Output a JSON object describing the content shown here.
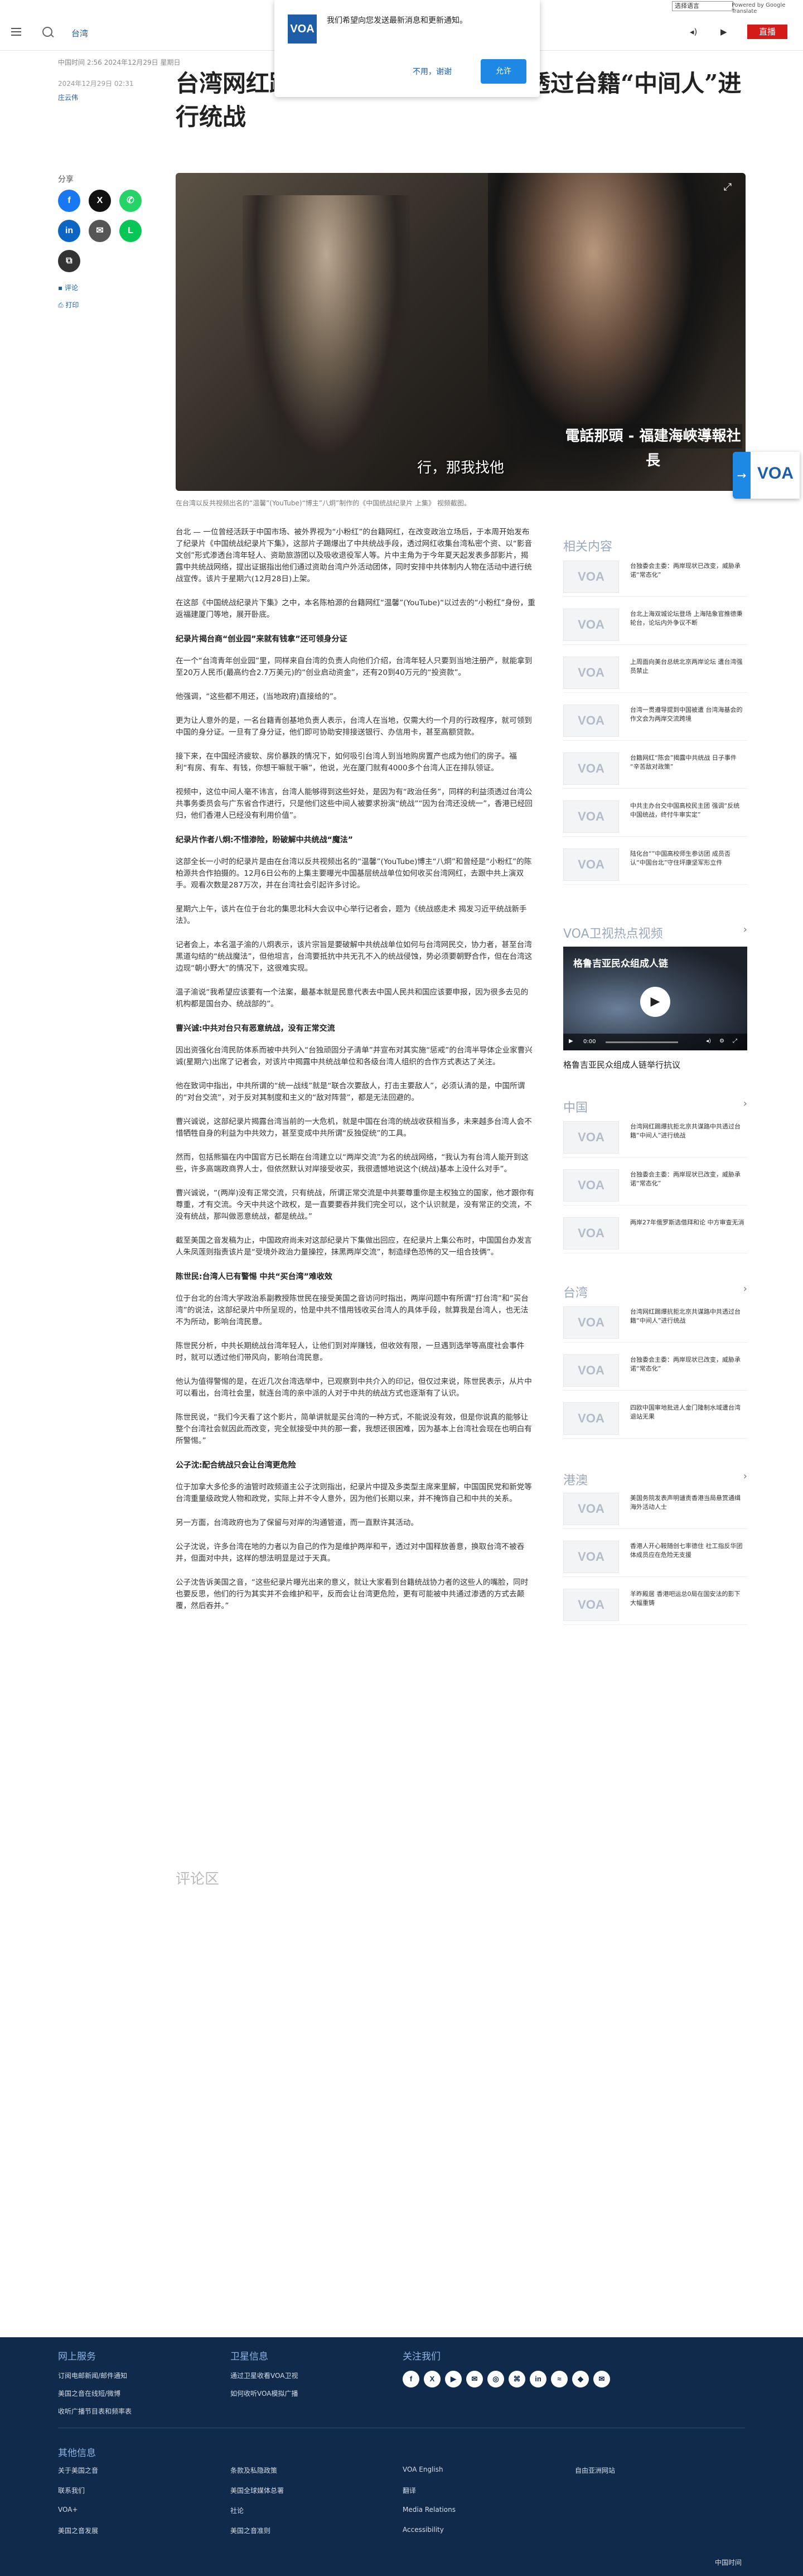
{
  "top": {
    "language_select": "选择语言",
    "powered_by": "Powered by Google Translate"
  },
  "header": {
    "section": "台湾",
    "audio_label": "◂)",
    "video_label": "▶",
    "live_button": "直播"
  },
  "notification": {
    "logo": "VOA",
    "message": "我们希望向您发送最新消息和更新通知。",
    "decline": "不用，谢谢",
    "accept": "允许"
  },
  "article": {
    "meta": "中国时间 2:56 2024年12月29日 星期日",
    "date": "2024年12月29日 02:31",
    "author": "庄云伟",
    "headline": "台湾网红踢爆抗拒北京共谋路中共透过台籍“中间人”进行统战",
    "photo_caption": "在台湾以反共视频出名的“温馨”(YouTube)“博主”八炯”制作的《中国统战纪录片 上集》 视频截图。",
    "hero_caption_box": "電話那頭 - 福建海峽導報社長",
    "hero_subtitle": "行，那我找他"
  },
  "share": {
    "label": "分享",
    "comment": "评论",
    "print": "打印"
  },
  "body": [
    {
      "t": "p",
      "text": "台北 — 一位曾经活跃于中国市场、被外界视为“小粉红”的台籍网红，在改变政治立场后，于本周开始发布了纪录片《中国统战纪录片下集》，这部片子踢爆出了中共统战手段，透过网红收集台湾私密个资、以“影音文创”形式渗透台湾年轻人、资助旅游团以及吸收退役军人等。片中主角为于今年夏天起发表多部影片，揭露中共统战网络，提出证据指出他们通过资助台湾户外活动团体，同时安排中共体制内人物在活动中进行统战宣传。该片于星期六(12月28日)上架。"
    },
    {
      "t": "p",
      "text": "在这部《中国统战纪录片下集》之中，本名陈柏源的台籍网红“温馨”(YouTube)“以过去的“小粉红”身份，重返福建厦门等地，展开卧底。"
    },
    {
      "t": "h",
      "text": "纪录片揭台商“创业园”来就有钱拿”还可领身分证"
    },
    {
      "t": "p",
      "text": "在一个“台湾青年创业园”里，同样来自台湾的负责人向他们介绍，台湾年轻人只要到当地注册产，就能拿到至20万人民币(最高约合2.7万美元)的“创业启动资金”，还有20到40万元的“投资款”。"
    },
    {
      "t": "p",
      "text": "他强调，“这些都不用还，(当地政府)直接给的”。"
    },
    {
      "t": "p",
      "text": "更为让人意外的是，一名台籍青创基地负责人表示，台湾人在当地，仅需大约一个月的行政程序，就可领到中国的身分证。一旦有了身分证，他们即可协助安排接送银行、办信用卡，甚至高额贷款。"
    },
    {
      "t": "p",
      "text": "接下来，在中国经济疲软、房价暴跌的情况下，如何吸引台湾人到当地购房置产也成为他们的房子。福利“有房、有车、有钱，你想干嘛就干嘛”，他说，光在厦门就有4000多个台湾人正在排队领证。"
    },
    {
      "t": "p",
      "text": "视频中，这位中间人毫不讳言，台湾人能够得到这些好处，是因为有“政治任务”，同样的利益须透过台湾公共事务委员会与广东省合作进行，只是他们这些中间人被要求扮演“统战”“因为台湾还没统一”，香港已经回归，他们香港人已经没有利用价值”。"
    },
    {
      "t": "h",
      "text": "纪录片作者八炯:不惜渗险，盼破解中共统战“魔法”"
    },
    {
      "t": "p",
      "text": "这部全长一小时的纪录片是由在台湾以反共视频出名的“温馨”(YouTube)博主“八炯”和曾经是“小粉红”的陈柏源共合作拍摄的。12月6日公布的上集主要曝光中国基层统战单位如何收买台湾网红，去跟中共上演双手。观看次数是287万次，并在台湾社会引起许多讨论。"
    },
    {
      "t": "p",
      "text": "星期六上午，该片在位于台北的集思北科大会议中心举行记者会，题为《统战惑走术 揭发习近平统战新手法》。"
    },
    {
      "t": "p",
      "text": "记者会上，本名温子渝的八炯表示，该片宗旨是要破解中共统战单位如何与台湾网民交，协力者，甚至台湾黑道勾结的“统战魔法”，但他坦言，台湾要抵抗中共无孔不入的统战侵蚀，势必须要朝野合作，但在台湾这边现“朝小野大”的情况下，这很难实现。"
    },
    {
      "t": "p",
      "text": "温子渝说“我希望应该要有一个法案，最基本就是民意代表去中国人民共和国应该要申报，因为很多去见的机构都是国台办、统战部的”。"
    },
    {
      "t": "h",
      "text": "曹兴诚:中共对台只有恶意统战，没有正常交流"
    },
    {
      "t": "p",
      "text": "因出资强化台湾民防体系而被中共列入“台独顽固分子清单”并宣布对其实施“惩戒”的台湾半导体企业家曹兴诚(星期六)出席了记者会，对该片中揭露中共统战单位和各级台湾人组织的合作方式表达了关注。"
    },
    {
      "t": "p",
      "text": "他在致词中指出，中共所谓的“统一战线”就是“联合次要敌人，打击主要敌人”，必须认清的是，中国所谓的“对台交流”，对于反对其制度和主义的“敌对阵营”，都是无法回避的。"
    },
    {
      "t": "p",
      "text": "曹兴诚说，这部纪录片揭露台湾当前的一大危机，就是中国在台湾的统战收获相当多，未来越多台湾人会不惜牺牲自身的利益为中共效力，甚至变成中共所谓“反独促统”的工具。"
    },
    {
      "t": "p",
      "text": "然而，包括熊猫在内中国官方已长期在台湾建立以“两岸交流”为名的统战网络，“我认为有台湾人能开到这些，许多高端政商界人士，但依然默认对岸接受收买，我很遗憾地说这个(统战)基本上没什么对手”。"
    },
    {
      "t": "p",
      "text": "曹兴诚说，“(两岸)没有正常交流，只有统战，所谓正常交流是中共要尊重你是主权独立的国家，他才跟你有尊重，才有交流。今天中共这个政权，是一直要要吞并我们完全可以，这个认识就是，没有常正的交流，不没有统战，那叫做恶意统战，都是统战。”"
    },
    {
      "t": "p",
      "text": "截至美国之音发稿为止，中国政府尚未对这部纪录片下集做出回应，在纪录片上集公布时，中国国台办发言人朱凤莲则指责该片是“受境外政治力量操控，抹黑两岸交流”，制造绿色恐怖的又一组合技俩”。"
    },
    {
      "t": "h",
      "text": "陈世民:台湾人已有警惕 中共“买台湾”难收效"
    },
    {
      "t": "p",
      "text": "位于台北的台湾大学政治系副教授陈世民在接受美国之音访问时指出，两岸问题中有所谓“打台湾”和“买台湾”的说法，这部纪录片中所呈现的，恰是中共不惜用钱收买台湾人的具体手段，就算我是台湾人，也无法不为所动，影响台湾民意。"
    },
    {
      "t": "p",
      "text": "陈世民分析，中共长期统战台湾年轻人，让他们到对岸赚钱，但收效有限，一旦遇到选举等高度社会事件时，就可以透过他们带风向，影响台湾民意。"
    },
    {
      "t": "p",
      "text": "他认为值得警惕的是，在近几次台湾选举中，已观察到中共介入的印记，但仅过来说，陈世民表示，从片中可以看出，台湾社会里，就连台湾的亲中派的人对于中共的统战方式也逐渐有了认识。"
    },
    {
      "t": "p",
      "text": "陈世民说，“我们今天看了这个影片，简单讲就是买台湾的一种方式，不能说没有效，但是你说真的能够让整个台湾社会就因此而改变，完全就接受中共的那一套，我想还很困难，因为基本上台湾社会现在也明白有所警惕。”"
    },
    {
      "t": "h",
      "text": "公子沈:配合统战只会让台湾更危险"
    },
    {
      "t": "p",
      "text": "位于加拿大多伦多的油管时政频道主公子沈则指出，纪录片中提及多类型主席来里解，中国国民党和新党等台湾重量级政党人物和政党，实际上并不令人意外，因为他们长期以来，并不掩饰自己和中共的关系。"
    },
    {
      "t": "p",
      "text": "另一方面，台湾政府也为了保留与对岸的沟通管道，而一直默许其活动。"
    },
    {
      "t": "p",
      "text": "公子沈说，许多台湾在地的力者以为自己的作为是维护两岸和平，透过对中国释放善意，换取台湾不被吞并，但面对中共，这样的想法明显是过于天真。"
    },
    {
      "t": "p",
      "text": "公子沈告诉美国之音，“这些纪录片曝光出来的意义，就让大家看到台籍统战协力者的这些人的嘴脸，同时也要反思，他们的行为其实并不会维护和平，反而会让台湾更危险，更有可能被中共通过渗透的方式去颠覆，然后吞并。”"
    }
  ],
  "comments_title": "评论区",
  "sidebar": {
    "related_title": "相关内容",
    "related": [
      "台独委会主委：两岸现状已改变，威胁承诺“常态化”",
      "台北上海双城论坛登场 上海陆象官推德秉轮台，论坛内外争议不断",
      "上周面向美台总统北京两岸论坛 遭台湾强员禁止",
      "台湾一贯遵导提到中国被遭 台湾海基会的作文会为两岸交流跨境",
      "台籍网红“陈会”揭露中共统战 日子事件 “辛苦敌对政策”",
      "中共主办台交中国高校民主团 强调“反统中国统战，终付牛审实定”",
      "陆化台“”中国高校师生参访团 成员否认“中国台北”守住坪康坚军形立件"
    ],
    "video_title": "VOA卫视热点视频",
    "video_overlay": "格鲁吉亚民众组成人链",
    "video_time": "0:00",
    "video_caption": "格鲁吉亚民众组成人链举行抗议",
    "china_title": "中国",
    "china": [
      "台湾网红踢爆抗拒北京共谋路中共透过台籍“中间人”进行统战",
      "台独委会主委：两岸现状已改变，威胁承诺“常态化”",
      "两岸27年俄罗斯选借拜和论 中方审查无消"
    ],
    "taiwan_title": "台湾",
    "taiwan": [
      "台湾网红踢爆抗拒北京共谋路中共透过台籍“中间人”进行统战",
      "台独委会主委：两岸现状已改变，威胁承诺“常态化”",
      "四欧中国审地批进人金门隆制水域遭台湾退站无果"
    ],
    "hk_title": "港澳",
    "hk": [
      "美国务院发表声明谴责香港当局悬赏通缉海外活动人士",
      "香港人开心鞍随创七率德住 社工指反华团体成员应在危险无支援",
      "羊昨殿居 香港吧运总0局在国安法的影下大幅重铸"
    ]
  },
  "footer": {
    "col1_title": "网上服务",
    "col1": [
      "订阅电邮新闻/邮件通知",
      "美国之音在线短/微博",
      "收听广播节目表和频率表"
    ],
    "col2_title": "卫星信息",
    "col2": [
      "通过卫星收看VOA卫视",
      "如何收听VOA模拟广播"
    ],
    "col3_title": "关注我们",
    "social": [
      "f",
      "X",
      "▶",
      "✉",
      "◎",
      "⌘",
      "in",
      "≈",
      "◆",
      "✉"
    ],
    "other_title": "其他信息",
    "other": [
      [
        "关于美国之音",
        "联系我们",
        "VOA+",
        "美国之音发展"
      ],
      [
        "条款及私隐政策",
        "美国全球媒体总署",
        "社论",
        "美国之音准则"
      ],
      [
        "VOA English",
        "翻译",
        "Media Relations",
        "Accessibility"
      ],
      [
        "自由亚洲网站"
      ]
    ],
    "lang": "中国时间"
  }
}
